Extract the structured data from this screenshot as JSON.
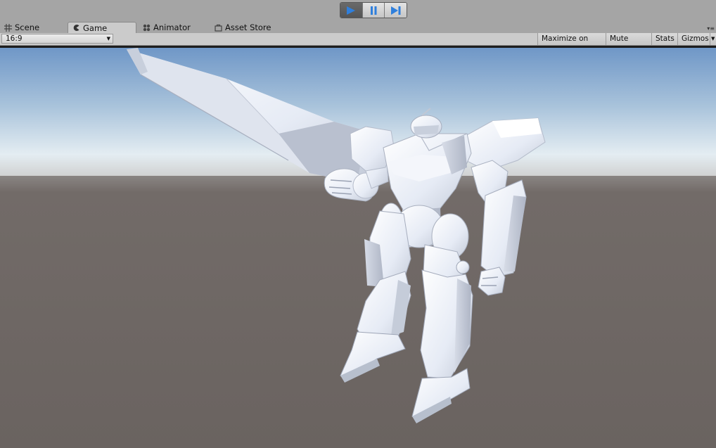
{
  "toolbar": {
    "play_icon": "play-icon",
    "pause_icon": "pause-icon",
    "step_icon": "step-icon",
    "play_active": true
  },
  "tabs": [
    {
      "label": "Scene",
      "icon": "scene-grid-icon"
    },
    {
      "label": "Game",
      "icon": "game-pacman-icon",
      "active": true
    },
    {
      "label": "Animator",
      "icon": "animator-icon"
    },
    {
      "label": "Asset Store",
      "icon": "asset-store-icon"
    }
  ],
  "game_view": {
    "aspect": "16:9",
    "buttons": [
      "Maximize on Play",
      "Mute audio",
      "Stats",
      "Gizmos"
    ]
  },
  "colors": {
    "accent": "#2f7fdc",
    "sky_top": "#6f97c7",
    "horizon": "#e4edf2",
    "ground": "#6b6461"
  }
}
